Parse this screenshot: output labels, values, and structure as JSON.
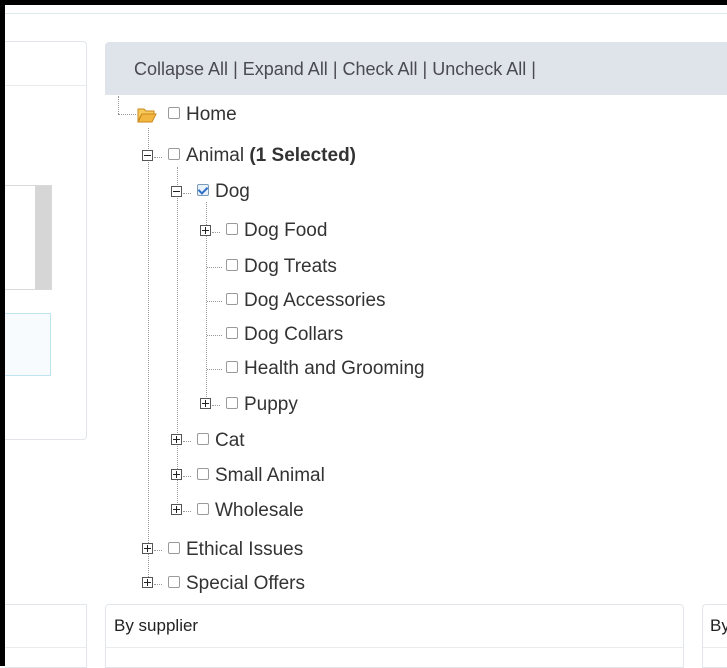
{
  "toolbar": {
    "collapse_all": "Collapse All",
    "expand_all": "Expand All",
    "check_all": "Check All",
    "uncheck_all": "Uncheck All",
    "separator": "|"
  },
  "tree": {
    "home": "Home",
    "animal": "Animal",
    "animal_selected": "(1 Selected)",
    "dog": "Dog",
    "dog_food": "Dog Food",
    "dog_treats": "Dog Treats",
    "dog_accessories": "Dog Accessories",
    "dog_collars": "Dog Collars",
    "health_grooming": "Health and Grooming",
    "puppy": "Puppy",
    "cat": "Cat",
    "small_animal": "Small Animal",
    "wholesale": "Wholesale",
    "ethical_issues": "Ethical Issues",
    "special_offers": "Special Offers"
  },
  "panels": {
    "by_supplier": "By supplier",
    "right_head": "By"
  },
  "colors": {
    "toolbar_bg": "#dfe3ea",
    "checkbox_check": "#2f6fc7",
    "folder": "#f3b640"
  },
  "icons": [
    "folder-open-icon",
    "expand-icon",
    "collapse-icon",
    "checkbox-icon"
  ]
}
